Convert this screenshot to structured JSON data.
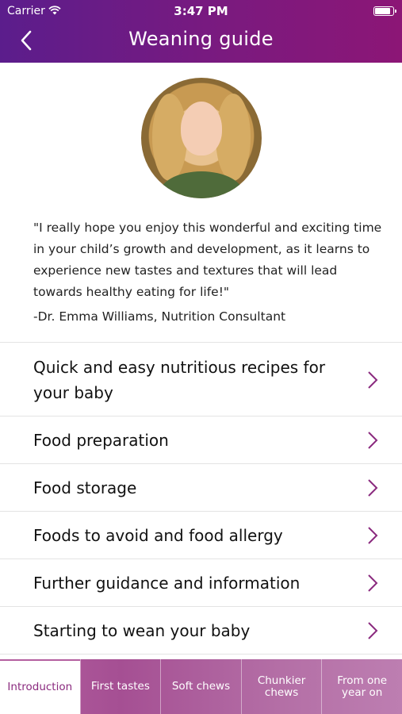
{
  "status_bar": {
    "carrier": "Carrier",
    "time": "3:47 PM",
    "battery_level": 0.92
  },
  "nav": {
    "title": "Weaning guide",
    "back_icon": "chevron-left-icon"
  },
  "intro": {
    "quote": "\"I really hope you enjoy this wonderful and exciting time in your child’s growth and development, as it learns to experience new tastes and textures that will lead towards healthy eating for life!\"",
    "attribution": "-Dr. Emma Williams, Nutrition Consultant"
  },
  "menu": {
    "items": [
      {
        "label": "Quick and easy nutritious recipes for your baby"
      },
      {
        "label": "Food preparation"
      },
      {
        "label": "Food storage"
      },
      {
        "label": "Foods to avoid and food allergy"
      },
      {
        "label": "Further guidance and information"
      },
      {
        "label": "Starting to wean your baby"
      }
    ]
  },
  "tabs": [
    {
      "label": "Introduction",
      "active": true
    },
    {
      "label": "First tastes",
      "active": false
    },
    {
      "label": "Soft chews",
      "active": false
    },
    {
      "label": "Chunkier chews",
      "active": false
    },
    {
      "label": "From one year on",
      "active": false
    }
  ],
  "colors": {
    "header_start": "#5b1d8c",
    "header_end": "#8c1676",
    "chevron": "#8a2a7e",
    "tab_bar": "#b45fa0"
  }
}
